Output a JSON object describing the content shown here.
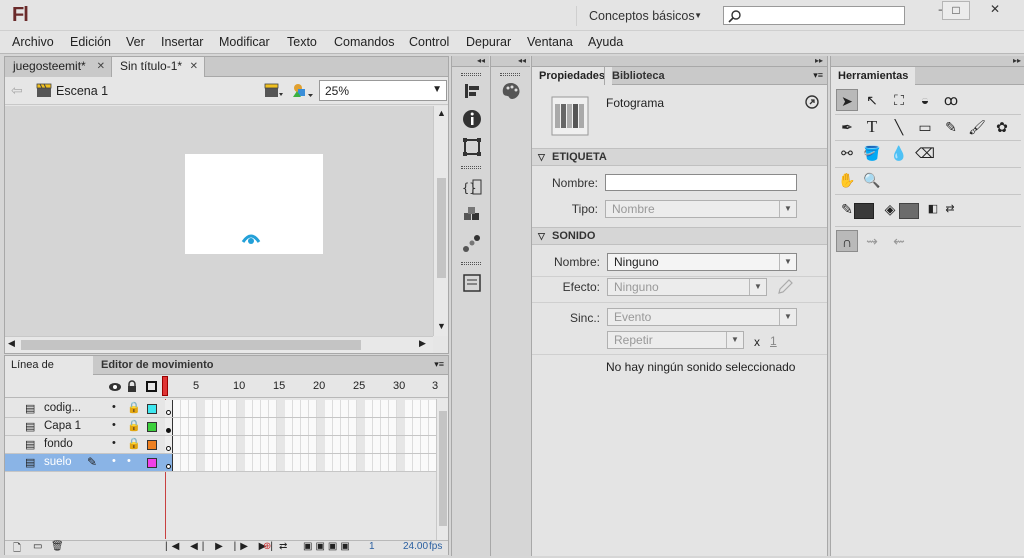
{
  "app": {
    "logo": "Fl",
    "workspace": "Conceptos básicos",
    "search_placeholder": ""
  },
  "window_controls": {
    "minimize": "–",
    "maximize": "□",
    "close": "✕"
  },
  "menu": [
    "Archivo",
    "Edición",
    "Ver",
    "Insertar",
    "Modificar",
    "Texto",
    "Comandos",
    "Control",
    "Depurar",
    "Ventana",
    "Ayuda"
  ],
  "doc_tabs": [
    {
      "label": "juegosteemit*",
      "active": false
    },
    {
      "label": "Sin título-1*",
      "active": true
    }
  ],
  "scene": {
    "label": "Escena 1",
    "zoom": "25%"
  },
  "timeline": {
    "tabs": [
      "Línea de tiempo",
      "Editor de movimiento"
    ],
    "frame_numbers": [
      "5",
      "10",
      "15",
      "20",
      "25",
      "30",
      "3"
    ],
    "layers": [
      {
        "name": "codig...",
        "color": "#3ee7ef",
        "selected": false
      },
      {
        "name": "Capa 1",
        "color": "#3cd03c",
        "selected": false
      },
      {
        "name": "fondo",
        "color": "#ef8020",
        "selected": false
      },
      {
        "name": "suelo",
        "color": "#f040e8",
        "selected": true
      }
    ],
    "current_frame": "1",
    "fps": "24.00",
    "fps_unit": "fps"
  },
  "properties": {
    "tabs": [
      "Propiedades",
      "Biblioteca"
    ],
    "object_type": "Fotograma",
    "label_section": {
      "title": "ETIQUETA",
      "name_label": "Nombre:",
      "name_value": "",
      "type_label": "Tipo:",
      "type_value": "Nombre"
    },
    "sound_section": {
      "title": "SONIDO",
      "name_label": "Nombre:",
      "name_value": "Ninguno",
      "effect_label": "Efecto:",
      "effect_value": "Ninguno",
      "sync_label": "Sinc.:",
      "sync_value": "Evento",
      "repeat_value": "Repetir",
      "repeat_x": "x",
      "repeat_count": "1",
      "status": "No hay ningún sonido seleccionado"
    }
  },
  "tools": {
    "title": "Herramientas"
  }
}
